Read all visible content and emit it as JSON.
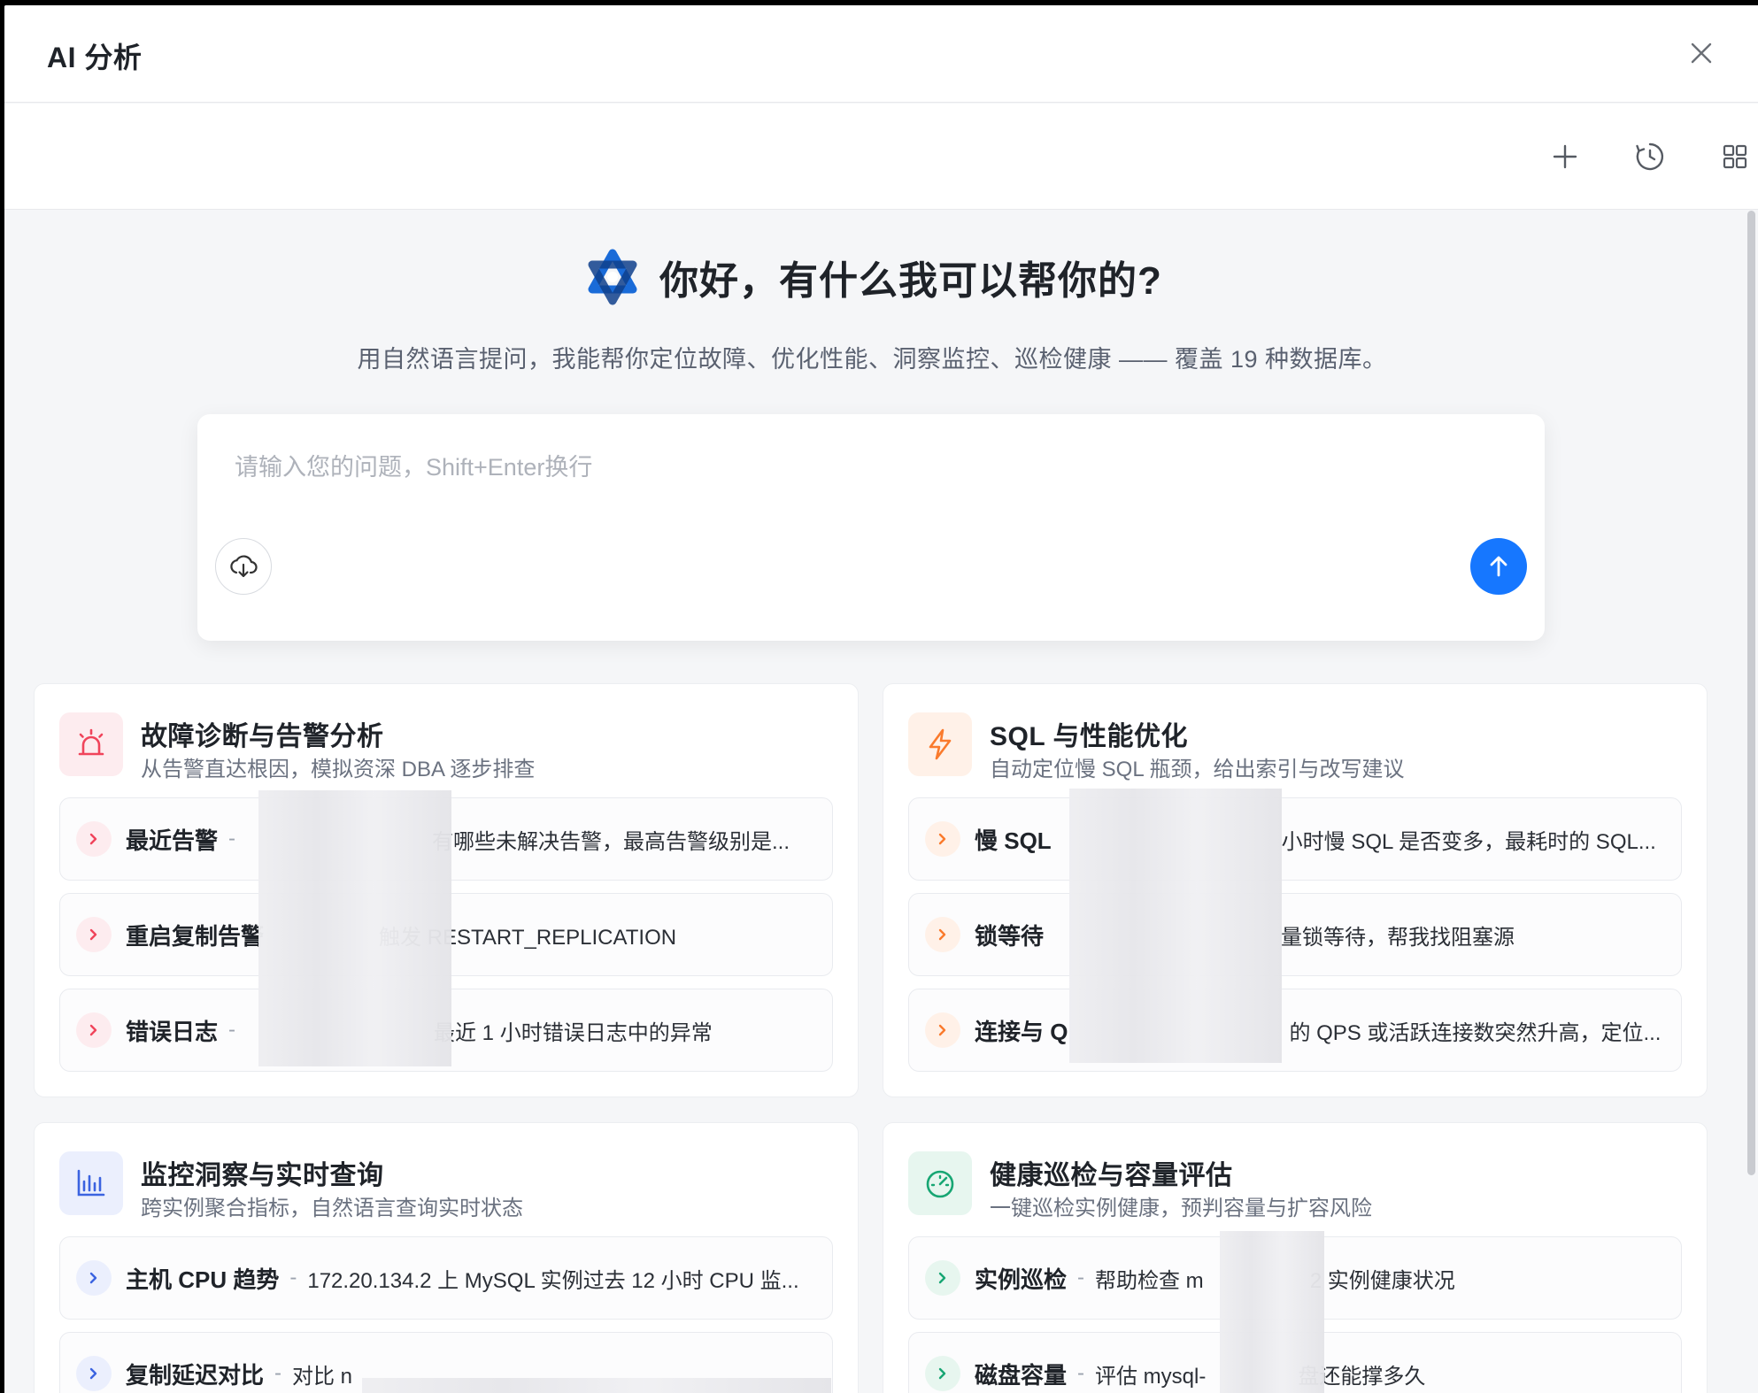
{
  "window": {
    "title": "AI 分析"
  },
  "hero": {
    "title": "你好，有什么我可以帮你的?",
    "subtitle": "用自然语言提问，我能帮你定位故障、优化性能、洞察监控、巡检健康 —— 覆盖 19 种数据库。"
  },
  "input": {
    "placeholder": "请输入您的问题，Shift+Enter换行"
  },
  "icons": {
    "close": "close-icon",
    "new_chat": "plus-icon",
    "history": "history-icon",
    "apps": "grid-icon",
    "upload": "cloud-upload-icon",
    "send": "arrow-up-icon"
  },
  "colors": {
    "accent": "#1677ff",
    "red": "#f0445b",
    "orange": "#fa7a2c",
    "blue": "#3b63e0",
    "green": "#17a673"
  },
  "cards": [
    {
      "title": "故障诊断与告警分析",
      "desc": "从告警直达根因，模拟资深 DBA 逐步排查",
      "items": [
        {
          "label": "最近告警",
          "text": "有哪些未解决告警，最高告警级别是..."
        },
        {
          "label": "重启复制告警",
          "text": "触发 RESTART_REPLICATION"
        },
        {
          "label": "错误日志",
          "text": "最近 1 小时错误日志中的异常"
        }
      ]
    },
    {
      "title": "SQL 与性能优化",
      "desc": "自动定位慢 SQL 瓶颈，给出索引与改写建议",
      "items": [
        {
          "label": "慢 SQL",
          "text": "小时慢 SQL 是否变多，最耗时的 SQL..."
        },
        {
          "label": "锁等待",
          "text": "量锁等待，帮我找阻塞源"
        },
        {
          "label": "连接与 Q",
          "text": "的 QPS 或活跃连接数突然升高，定位..."
        }
      ]
    },
    {
      "title": "监控洞察与实时查询",
      "desc": "跨实例聚合指标，自然语言查询实时状态",
      "items": [
        {
          "label": "主机 CPU 趋势",
          "text": "172.20.134.2 上 MySQL 实例过去 12 小时 CPU 监..."
        },
        {
          "label": "复制延迟对比",
          "text": "对比 n"
        }
      ]
    },
    {
      "title": "健康巡检与容量评估",
      "desc": "一键巡检实例健康，预判容量与扩容风险",
      "items": [
        {
          "label": "实例巡检",
          "text": "帮助检查 m"
        },
        {
          "label": "磁盘容量",
          "text": "评估 mysql-"
        }
      ]
    }
  ],
  "tail_text": {
    "card4_item1": "2 实例健康状况",
    "card4_item2": "盘还能撑多久"
  }
}
